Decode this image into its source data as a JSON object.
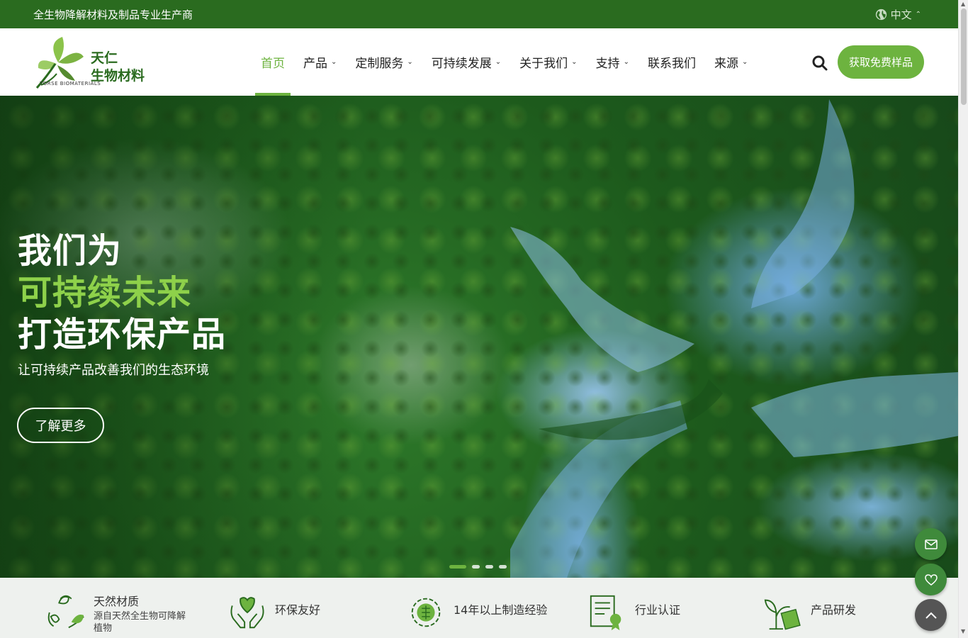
{
  "topbar": {
    "tagline": "全生物降解材料及制品专业生产商",
    "language": "中文"
  },
  "logo": {
    "name_line1": "天仁",
    "name_line2": "生物材料",
    "sub_text": "TORSE BIOMATERIALS"
  },
  "nav": {
    "items": [
      {
        "label": "首页",
        "has_dropdown": false,
        "active": true
      },
      {
        "label": "产品",
        "has_dropdown": true
      },
      {
        "label": "定制服务",
        "has_dropdown": true
      },
      {
        "label": "可持续发展",
        "has_dropdown": true
      },
      {
        "label": "关于我们",
        "has_dropdown": true
      },
      {
        "label": "支持",
        "has_dropdown": true
      },
      {
        "label": "联系我们",
        "has_dropdown": false
      },
      {
        "label": "来源",
        "has_dropdown": true
      }
    ],
    "cta_label": "获取免费样品"
  },
  "hero": {
    "line1": "我们为",
    "line2": "可持续未来",
    "line3": "打造环保产品",
    "subtitle": "让可持续产品改善我们的生态环境",
    "button_label": "了解更多",
    "slide_count": 4,
    "active_slide": 1
  },
  "features": [
    {
      "title": "天然材质",
      "desc": "源自天然全生物可降解植物",
      "icon": "leaf-cycle-icon"
    },
    {
      "title": "环保友好",
      "desc": "",
      "icon": "hands-heart-icon"
    },
    {
      "title": "14年以上制造经验",
      "desc": "",
      "icon": "gear-chip-icon"
    },
    {
      "title": "行业认证",
      "desc": "",
      "icon": "certificate-icon"
    },
    {
      "title": "产品研发",
      "desc": "",
      "icon": "plant-document-icon"
    }
  ],
  "colors": {
    "brand_dark": "#2a6b1f",
    "accent": "#6db33f",
    "hero_highlight": "#8ed14a"
  }
}
